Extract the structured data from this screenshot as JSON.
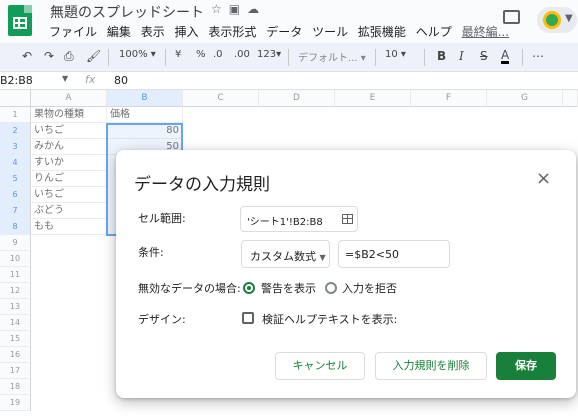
{
  "header": {
    "doc_title": "無題のスプレッドシート",
    "menu": [
      "ファイル",
      "編集",
      "表示",
      "挿入",
      "表示形式",
      "データ",
      "ツール",
      "拡張機能",
      "ヘルプ"
    ],
    "last_edit": "最終編..."
  },
  "toolbar": {
    "zoom": "100%",
    "currency": "¥",
    "percent": "%",
    "decrease_decimal": ".0",
    "increase_decimal": ".00",
    "more_formats": "123",
    "font": "デフォルト...",
    "font_size": "10",
    "bold": "B",
    "italic": "I",
    "strikethrough": "S",
    "text_color": "A",
    "more": "⋯"
  },
  "formula_bar": {
    "name_box": "B2:B8",
    "fx": "fx",
    "value": "80"
  },
  "sheet": {
    "columns": [
      "A",
      "B",
      "C",
      "D",
      "E",
      "F",
      "G"
    ],
    "rows": [
      "1",
      "2",
      "3",
      "4",
      "5",
      "6",
      "7",
      "8",
      "9",
      "10",
      "11",
      "12",
      "13",
      "14",
      "15",
      "16",
      "17",
      "18",
      "19"
    ],
    "col_a": [
      "果物の種類",
      "いちご",
      "みかん",
      "すいか",
      "りんご",
      "いちご",
      "ぶどう",
      "もも"
    ],
    "col_b": [
      "価格",
      "80",
      "50"
    ]
  },
  "dialog": {
    "title": "データの入力規則",
    "close": "×",
    "range_label": "セル範囲:",
    "range_value": "'シート1'!B2:B8",
    "criteria_label": "条件:",
    "criteria_type": "カスタム数式",
    "criteria_value": "=$B2<50",
    "invalid_label": "無効なデータの場合:",
    "option_warning": "警告を表示",
    "option_reject": "入力を拒否",
    "appearance_label": "デザイン:",
    "help_text_label": "検証ヘルプテキストを表示:",
    "cancel": "キャンセル",
    "remove": "入力規則を削除",
    "save": "保存",
    "accent_color": "#188038"
  }
}
